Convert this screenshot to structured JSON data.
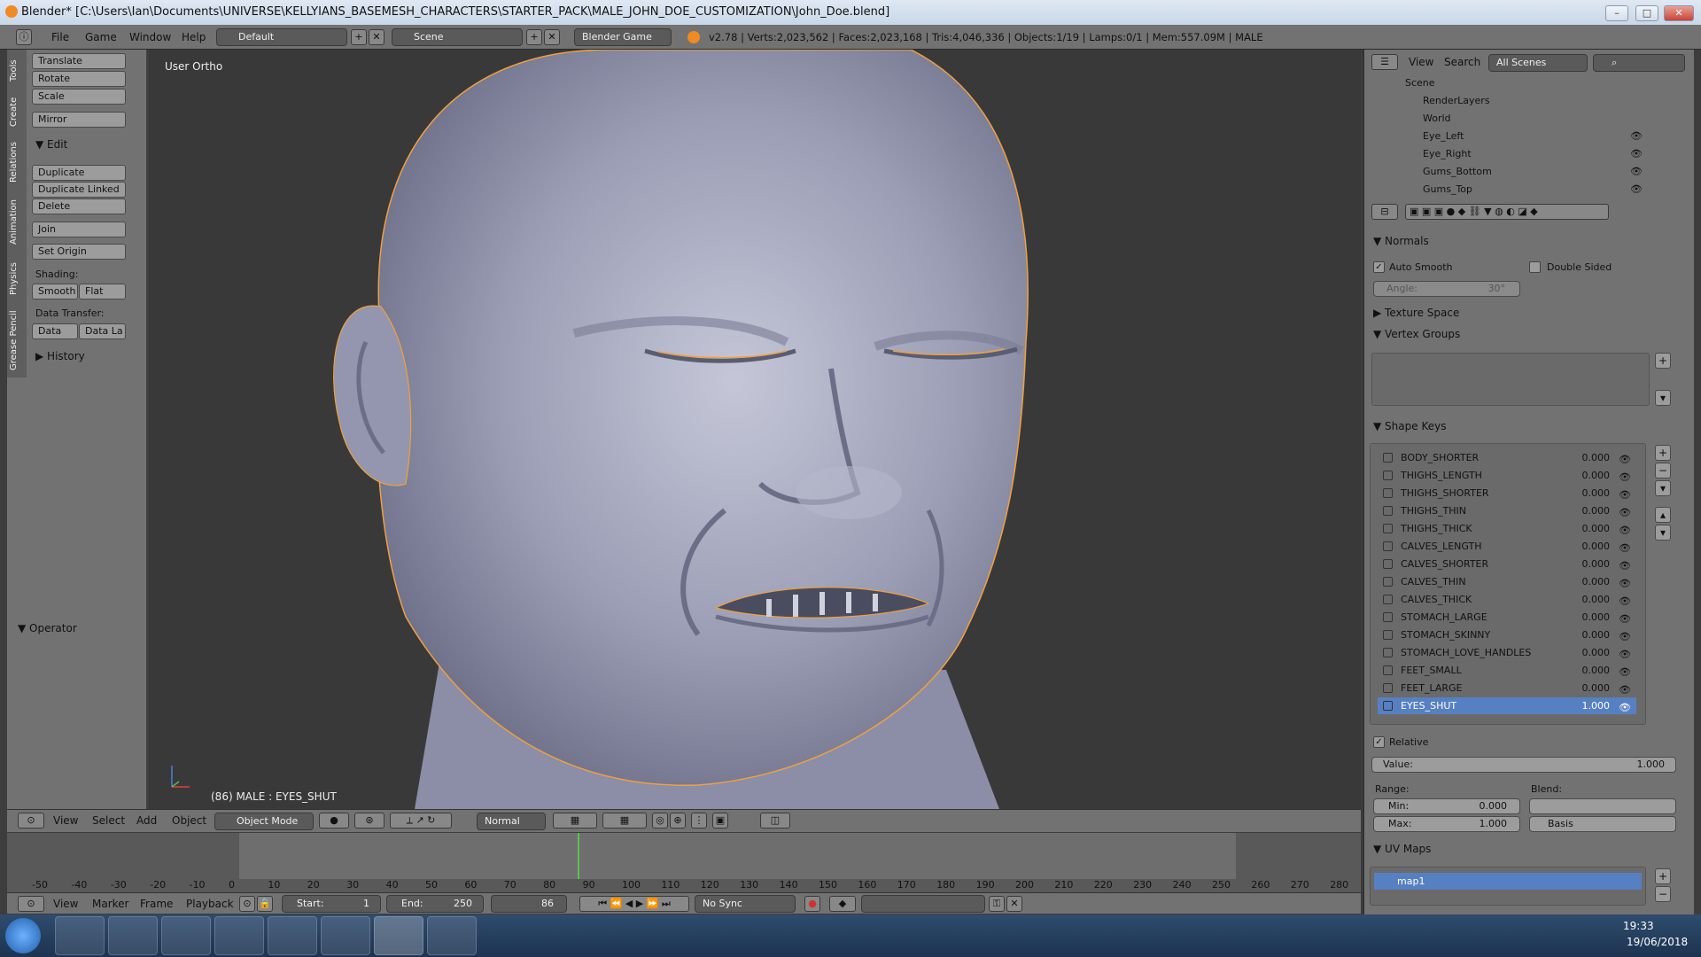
{
  "window": {
    "title": "Blender* [C:\\Users\\Ian\\Documents\\UNIVERSE\\KELLYIANS_BASEMESH_CHARACTERS\\STARTER_PACK\\MALE_JOHN_DOE_CUSTOMIZATION\\John_Doe.blend]"
  },
  "infobar": {
    "menus": [
      "File",
      "Game",
      "Window",
      "Help"
    ],
    "layout": "Default",
    "scene": "Scene",
    "engine": "Blender Game",
    "stats": "v2.78 | Verts:2,023,562 | Faces:2,023,168 | Tris:4,046,336 | Objects:1/19 | Lamps:0/1 | Mem:557.09M | MALE"
  },
  "toolshelf": {
    "tabs": [
      "Tools",
      "Create",
      "Relations",
      "Animation",
      "Physics",
      "Grease Pencil"
    ],
    "transform": [
      "Translate",
      "Rotate",
      "Scale"
    ],
    "mirror": "Mirror",
    "edit_header": "Edit",
    "edit_buttons": [
      "Duplicate",
      "Duplicate Linked",
      "Delete"
    ],
    "join": "Join",
    "set_origin": "Set Origin",
    "shading_label": "Shading:",
    "smooth": "Smooth",
    "flat": "Flat",
    "data_transfer_label": "Data Transfer:",
    "data": "Data",
    "data_layers": "Data La",
    "history": "History",
    "operator": "Operator"
  },
  "viewport": {
    "view_label": "User Ortho",
    "status": "(86) MALE : EYES_SHUT"
  },
  "view3d_header": {
    "menus": [
      "View",
      "Select",
      "Add",
      "Object"
    ],
    "mode": "Object Mode",
    "orientation": "Normal"
  },
  "timeline": {
    "ticks": [
      "-50",
      "-40",
      "-30",
      "-20",
      "-10",
      "0",
      "10",
      "20",
      "30",
      "40",
      "50",
      "60",
      "70",
      "80",
      "90",
      "100",
      "110",
      "120",
      "130",
      "140",
      "150",
      "160",
      "170",
      "180",
      "190",
      "200",
      "210",
      "220",
      "230",
      "240",
      "250",
      "260",
      "270",
      "280"
    ],
    "menus": [
      "View",
      "Marker",
      "Frame",
      "Playback"
    ],
    "start_label": "Start:",
    "start": "1",
    "end_label": "End:",
    "end": "250",
    "current": "86",
    "sync": "No Sync",
    "current_frame_value": 86
  },
  "outliner": {
    "menus": [
      "View",
      "Search"
    ],
    "filter": "All Scenes",
    "items": [
      "Scene",
      "RenderLayers",
      "World",
      "Eye_Left",
      "Eye_Right",
      "Gums_Bottom",
      "Gums_Top"
    ]
  },
  "properties": {
    "normals": "Normals",
    "auto_smooth": "Auto Smooth",
    "double_sided": "Double Sided",
    "angle_label": "Angle:",
    "angle": "30°",
    "texture_space": "Texture Space",
    "vertex_groups": "Vertex Groups",
    "shape_keys": "Shape Keys",
    "shape_key_items": [
      {
        "name": "BODY_SHORTER",
        "value": "0.000"
      },
      {
        "name": "THIGHS_LENGTH",
        "value": "0.000"
      },
      {
        "name": "THIGHS_SHORTER",
        "value": "0.000"
      },
      {
        "name": "THIGHS_THIN",
        "value": "0.000"
      },
      {
        "name": "THIGHS_THICK",
        "value": "0.000"
      },
      {
        "name": "CALVES_LENGTH",
        "value": "0.000"
      },
      {
        "name": "CALVES_SHORTER",
        "value": "0.000"
      },
      {
        "name": "CALVES_THIN",
        "value": "0.000"
      },
      {
        "name": "CALVES_THICK",
        "value": "0.000"
      },
      {
        "name": "STOMACH_LARGE",
        "value": "0.000"
      },
      {
        "name": "STOMACH_SKINNY",
        "value": "0.000"
      },
      {
        "name": "STOMACH_LOVE_HANDLES",
        "value": "0.000"
      },
      {
        "name": "FEET_SMALL",
        "value": "0.000"
      },
      {
        "name": "FEET_LARGE",
        "value": "0.000"
      },
      {
        "name": "EYES_SHUT",
        "value": "1.000"
      }
    ],
    "relative": "Relative",
    "value_label": "Value:",
    "value": "1.000",
    "range_label": "Range:",
    "blend_label": "Blend:",
    "min_label": "Min:",
    "min": "0.000",
    "max_label": "Max:",
    "max": "1.000",
    "basis": "Basis",
    "uv_maps": "UV Maps",
    "uv_map_name": "map1"
  },
  "taskbar": {
    "time": "19:33",
    "date": "19/06/2018"
  },
  "colors": {
    "selection": "#5680c2",
    "accent_orange": "#f08a24",
    "panel": "#727272"
  }
}
